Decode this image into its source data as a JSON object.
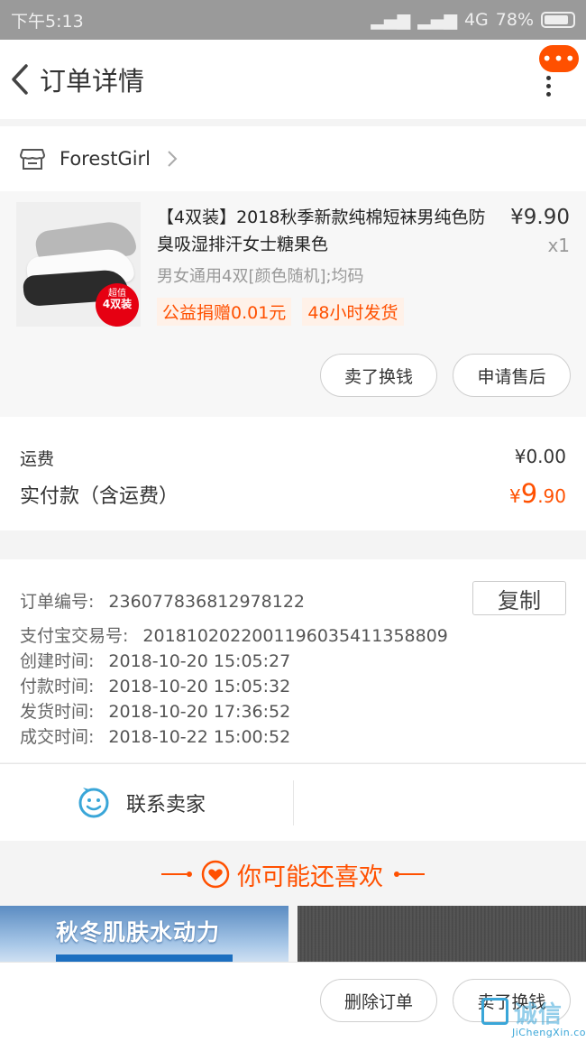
{
  "status_bar": {
    "time": "下午5:13",
    "network": "4G",
    "battery": "78%"
  },
  "navbar": {
    "title": "订单详情",
    "more_badge": "•••"
  },
  "shop": {
    "name": "ForestGirl"
  },
  "product": {
    "title": "【4双装】2018秋季新款纯棉短袜男纯色防臭吸湿排汗女士糖果色",
    "price": "¥9.90",
    "quantity": "x1",
    "spec": "男女通用4双[颜色随机];均码",
    "thumb_badge_small": "超值",
    "thumb_badge_big": "4双装",
    "tags": [
      "公益捐赠0.01元",
      "48小时发货"
    ],
    "buttons": {
      "sell": "卖了换钱",
      "after_sales": "申请售后"
    }
  },
  "summary": {
    "freight_label": "运费",
    "freight_value": "¥0.00",
    "paid_label": "实付款（含运费）",
    "paid_currency": "¥",
    "paid_int": "9",
    "paid_dec": ".90"
  },
  "order_info": {
    "copy_label": "复制",
    "rows": [
      {
        "label": "订单编号:",
        "value": "236077836812978122"
      },
      {
        "label": "支付宝交易号:",
        "value": "2018102022001196035411358809"
      },
      {
        "label": "创建时间:",
        "value": "2018-10-20 15:05:27"
      },
      {
        "label": "付款时间:",
        "value": "2018-10-20 15:05:32"
      },
      {
        "label": "发货时间:",
        "value": "2018-10-20 17:36:52"
      },
      {
        "label": "成交时间:",
        "value": "2018-10-22 15:00:52"
      }
    ]
  },
  "contact": {
    "label": "联系卖家"
  },
  "recommend": {
    "title": "你可能还喜欢",
    "banner_left_text": "秋冬肌肤水动力"
  },
  "bottom_bar": {
    "delete_label": "删除订单",
    "sell_label": "卖了换钱"
  },
  "watermark": {
    "cn": "诚信",
    "en": "JiChengXin.com"
  },
  "colors": {
    "accent": "#ff5000",
    "thumb_badge": "#e60012",
    "icon_blue": "#3aa6d8"
  }
}
